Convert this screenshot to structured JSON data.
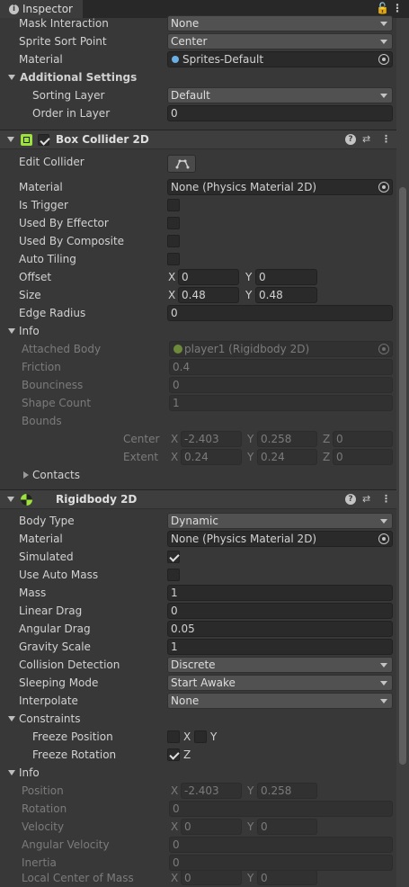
{
  "window": {
    "tab_title": "Inspector",
    "info_glyph": "i",
    "lock_glyph": "🔓",
    "menu_glyph": "⋮"
  },
  "sprite_renderer": {
    "mask_interaction": {
      "label": "Mask Interaction",
      "value": "None"
    },
    "sprite_sort_point": {
      "label": "Sprite Sort Point",
      "value": "Center"
    },
    "material": {
      "label": "Material",
      "value": "Sprites-Default"
    },
    "additional_settings": {
      "label": "Additional Settings",
      "sorting_layer": {
        "label": "Sorting Layer",
        "value": "Default"
      },
      "order_in_layer": {
        "label": "Order in Layer",
        "value": "0"
      }
    }
  },
  "box_collider": {
    "title": "Box Collider 2D",
    "enabled": true,
    "edit_collider": {
      "label": "Edit Collider"
    },
    "material": {
      "label": "Material",
      "value": "None (Physics Material 2D)"
    },
    "is_trigger": {
      "label": "Is Trigger",
      "checked": false
    },
    "used_by_effector": {
      "label": "Used By Effector",
      "checked": false
    },
    "used_by_composite": {
      "label": "Used By Composite",
      "checked": false
    },
    "auto_tiling": {
      "label": "Auto Tiling",
      "checked": false
    },
    "offset": {
      "label": "Offset",
      "x_label": "X",
      "x": "0",
      "y_label": "Y",
      "y": "0"
    },
    "size": {
      "label": "Size",
      "x_label": "X",
      "x": "0.48",
      "y_label": "Y",
      "y": "0.48"
    },
    "edge_radius": {
      "label": "Edge Radius",
      "value": "0"
    },
    "info": {
      "label": "Info",
      "attached_body": {
        "label": "Attached Body",
        "value": "player1 (Rigidbody 2D)"
      },
      "friction": {
        "label": "Friction",
        "value": "0.4"
      },
      "bounciness": {
        "label": "Bounciness",
        "value": "0"
      },
      "shape_count": {
        "label": "Shape Count",
        "value": "1"
      },
      "bounds": {
        "label": "Bounds",
        "center": {
          "label": "Center",
          "x_label": "X",
          "x": "-2.403",
          "y_label": "Y",
          "y": "0.258",
          "z_label": "Z",
          "z": "0"
        },
        "extent": {
          "label": "Extent",
          "x_label": "X",
          "x": "0.24",
          "y_label": "Y",
          "y": "0.24",
          "z_label": "Z",
          "z": "0"
        }
      },
      "contacts": {
        "label": "Contacts"
      }
    }
  },
  "rigidbody": {
    "title": "Rigidbody 2D",
    "body_type": {
      "label": "Body Type",
      "value": "Dynamic"
    },
    "material": {
      "label": "Material",
      "value": "None (Physics Material 2D)"
    },
    "simulated": {
      "label": "Simulated",
      "checked": true
    },
    "use_auto_mass": {
      "label": "Use Auto Mass",
      "checked": false
    },
    "mass": {
      "label": "Mass",
      "value": "1"
    },
    "linear_drag": {
      "label": "Linear Drag",
      "value": "0"
    },
    "angular_drag": {
      "label": "Angular Drag",
      "value": "0.05"
    },
    "gravity_scale": {
      "label": "Gravity Scale",
      "value": "1"
    },
    "collision_detection": {
      "label": "Collision Detection",
      "value": "Discrete"
    },
    "sleeping_mode": {
      "label": "Sleeping Mode",
      "value": "Start Awake"
    },
    "interpolate": {
      "label": "Interpolate",
      "value": "None"
    },
    "constraints": {
      "label": "Constraints",
      "freeze_position": {
        "label": "Freeze Position",
        "x_label": "X",
        "x_checked": false,
        "y_label": "Y",
        "y_checked": false
      },
      "freeze_rotation": {
        "label": "Freeze Rotation",
        "z_label": "Z",
        "z_checked": true
      }
    },
    "info": {
      "label": "Info",
      "position": {
        "label": "Position",
        "x_label": "X",
        "x": "-2.403",
        "y_label": "Y",
        "y": "0.258"
      },
      "rotation": {
        "label": "Rotation",
        "value": "0"
      },
      "velocity": {
        "label": "Velocity",
        "x_label": "X",
        "x": "0",
        "y_label": "Y",
        "y": "0"
      },
      "angular_velocity": {
        "label": "Angular Velocity",
        "value": "0"
      },
      "inertia": {
        "label": "Inertia",
        "value": "0"
      },
      "local_center_of_mass": {
        "label": "Local Center of Mass",
        "x_label": "X",
        "x": "0",
        "y_label": "Y",
        "y": "0"
      }
    }
  }
}
